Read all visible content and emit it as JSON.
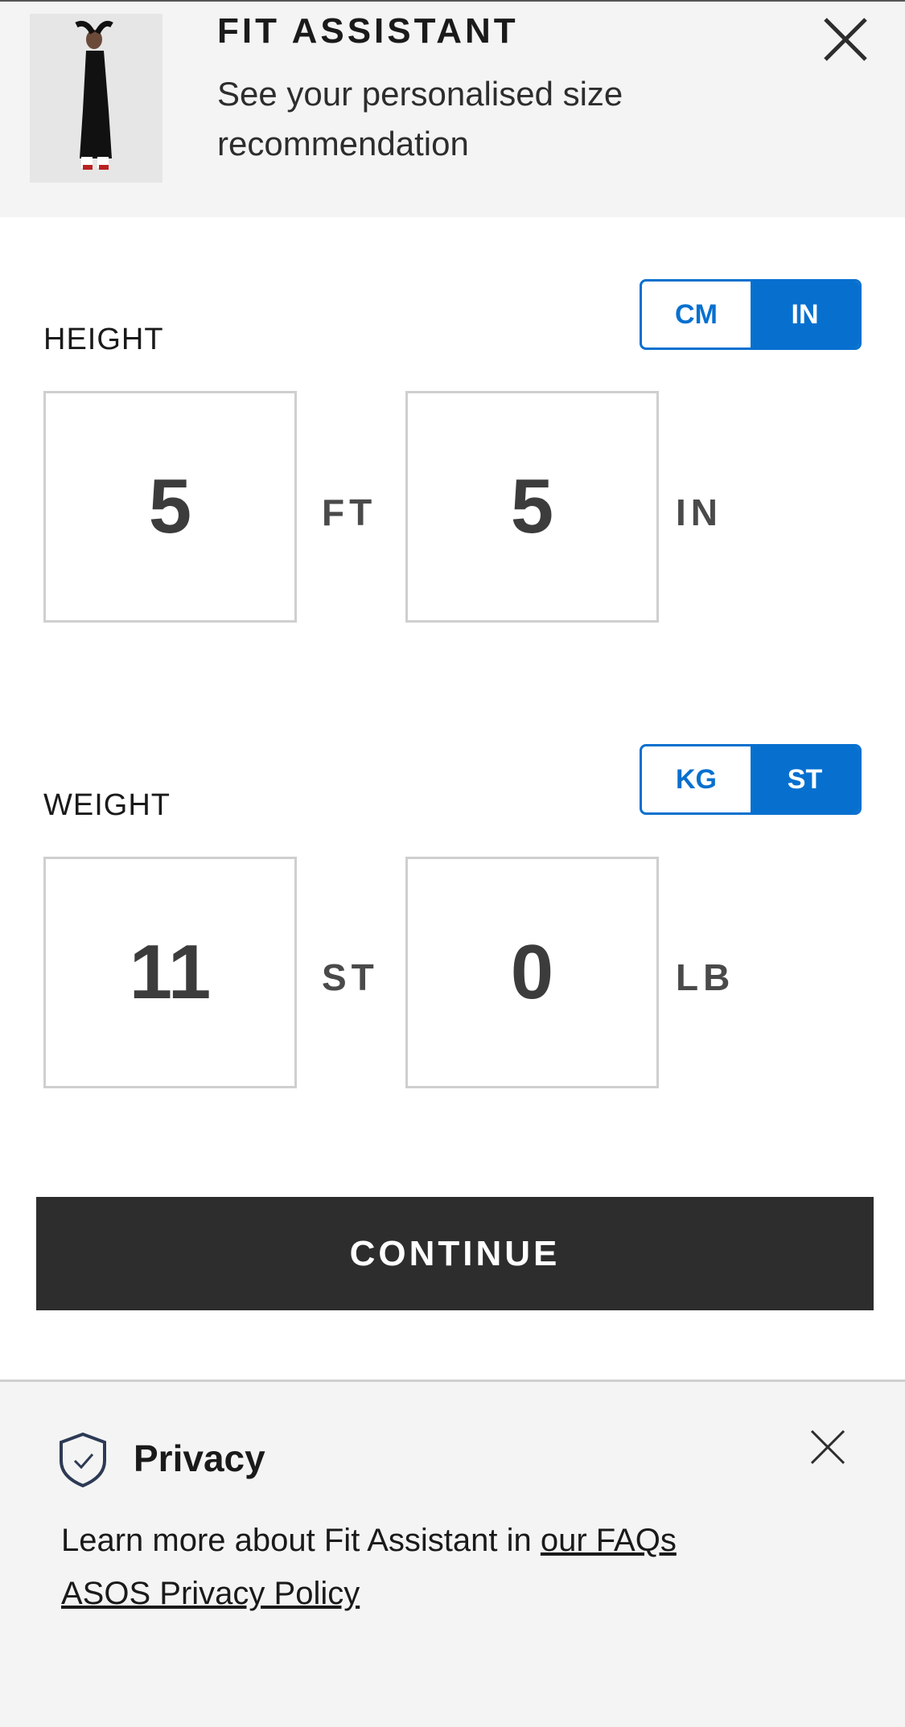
{
  "header": {
    "title": "FIT ASSISTANT",
    "subtitle": "See your personalised size recommendation",
    "close_icon": "close-icon",
    "product_image": "product-thumbnail"
  },
  "height": {
    "label": "HEIGHT",
    "unit_options": [
      "CM",
      "IN"
    ],
    "selected_unit": "IN",
    "feet_value": "5",
    "feet_unit": "FT",
    "inches_value": "5",
    "inches_unit": "IN"
  },
  "weight": {
    "label": "WEIGHT",
    "unit_options": [
      "KG",
      "ST"
    ],
    "selected_unit": "ST",
    "stones_value": "11",
    "stones_unit": "ST",
    "pounds_value": "0",
    "pounds_unit": "LB"
  },
  "continue_label": "CONTINUE",
  "privacy": {
    "title": "Privacy",
    "text": "Learn more about Fit Assistant in",
    "faq_link": "our FAQs",
    "policy_link": "ASOS Privacy Policy",
    "icon": "shield-check-icon",
    "close_icon": "close-icon"
  },
  "colors": {
    "accent": "#0770cf",
    "button_dark": "#2d2d2d",
    "panel_bg": "#f4f4f4"
  }
}
